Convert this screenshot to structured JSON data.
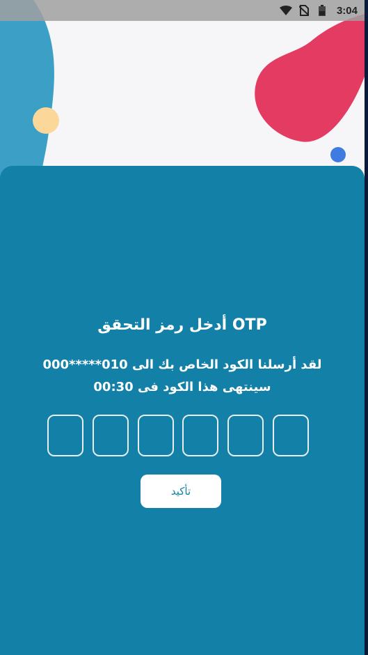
{
  "status_bar": {
    "time": "3:04",
    "icons": [
      "wifi-icon",
      "no-sim-icon",
      "battery-icon"
    ]
  },
  "otp": {
    "title": "OTP أدخل رمز التحقق",
    "message_line1": "لقد أرسلنا الكود الخاص بك الى 010*****000",
    "message_line2": "سينتهى هذا الكود فى 00:30",
    "digits": [
      "",
      "",
      "",
      "",
      "",
      ""
    ],
    "confirm_label": "تأكيد"
  },
  "colors": {
    "card": "#1380a8",
    "blob_left": "#3b9fc6",
    "blob_right": "#e43b63",
    "dot_yellow": "#fbd89a",
    "dot_blue": "#3f7be0"
  }
}
